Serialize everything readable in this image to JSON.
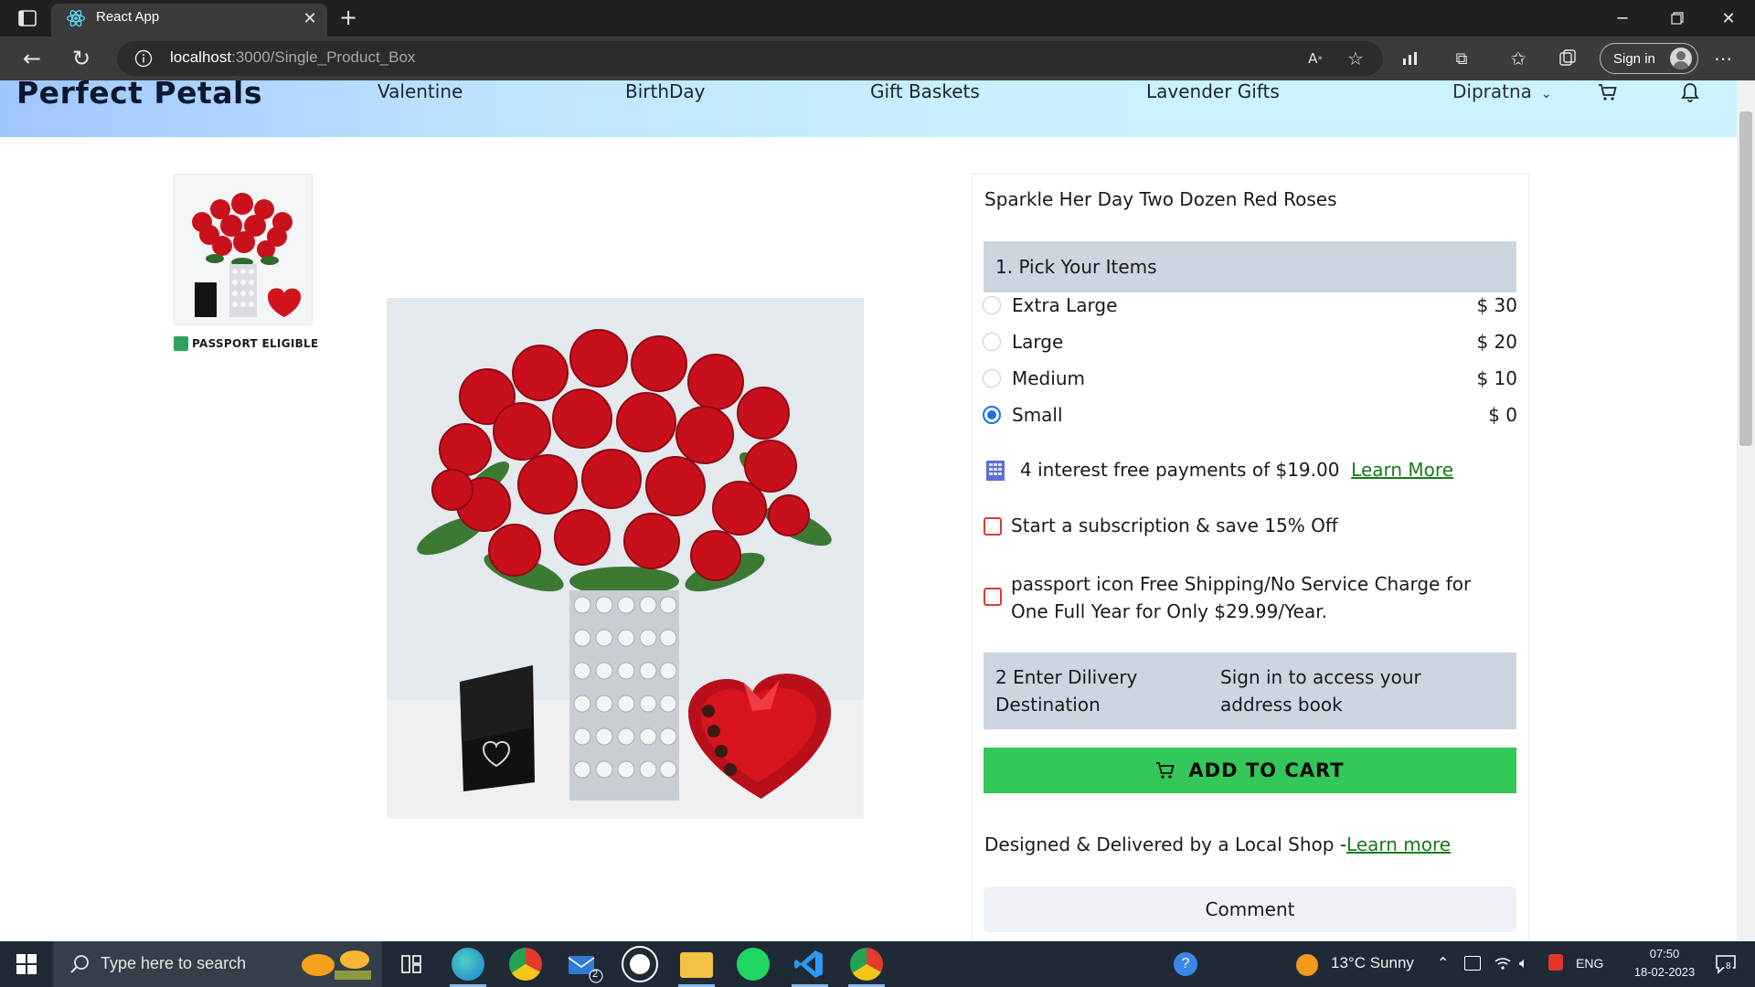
{
  "browser": {
    "tab_title": "React App",
    "url_host": "localhost",
    "url_path": ":3000/Single_Product_Box",
    "signin_label": "Sign in"
  },
  "navbar": {
    "brand": "Perfect Petals",
    "links": [
      "Valentine",
      "BirthDay",
      "Gift Baskets",
      "Lavender Gifts"
    ],
    "user": "Dipratna"
  },
  "gallery": {
    "passport_label": "PASSPORT ELIGIBLE"
  },
  "product": {
    "title": "Sparkle Her Day Two Dozen Red Roses",
    "pick_heading": "1. Pick Your Items",
    "options": [
      {
        "label": "Extra Large",
        "price": "$ 30",
        "selected": false
      },
      {
        "label": "Large",
        "price": "$ 20",
        "selected": false
      },
      {
        "label": "Medium",
        "price": "$ 10",
        "selected": false
      },
      {
        "label": "Small",
        "price": "$ 0",
        "selected": true
      }
    ],
    "payments_text": "4 interest free payments of $19.00",
    "payments_link": "Learn More",
    "subscription_text": "Start a subscription & save 15% Off",
    "passport_text": "passport icon Free Shipping/No Service Charge for One Full Year for Only $29.99/Year.",
    "delivery_heading": "2 Enter Dilivery Destination",
    "delivery_signin": "Sign in to access your address book",
    "add_to_cart": "ADD TO CART",
    "local_shop_text": "Designed & Delivered by a Local Shop -",
    "local_shop_link": "Learn more",
    "comment_label": "Comment"
  },
  "taskbar": {
    "search_placeholder": "Type here to search",
    "mail_badge": "2",
    "weather": "13°C  Sunny",
    "language": "ENG",
    "time": "07:50",
    "date": "18-02-2023",
    "notification_count": "8"
  }
}
